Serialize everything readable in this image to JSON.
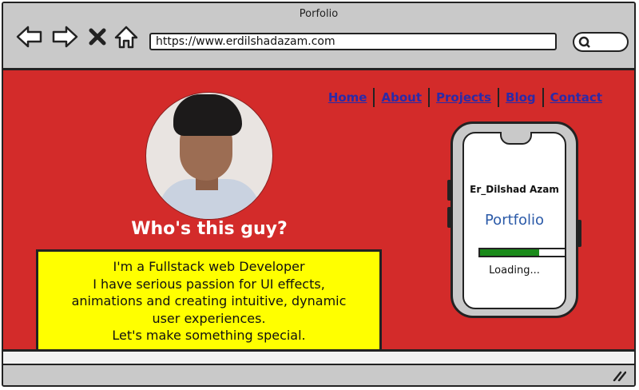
{
  "window": {
    "title": "Porfolio"
  },
  "browser": {
    "url": "https://www.erdilshadazam.com",
    "icons": [
      "back-arrow-icon",
      "forward-arrow-icon",
      "close-icon",
      "home-icon",
      "search-icon"
    ]
  },
  "nav": {
    "home": "Home",
    "about": "About",
    "projects": "Projects",
    "blog": "Blog",
    "contact": "Contact",
    "link_color": "#2b2aa8"
  },
  "hero": {
    "heading": "Who's this guy?",
    "bio_lines": [
      "I'm a Fullstack web Developer",
      "I have serious passion for UI effects,",
      "animations and creating intuitive, dynamic",
      "user experiences.",
      "Let's make something special."
    ]
  },
  "phone": {
    "name": "Er_Dilshad Azam",
    "title": "Portfolio",
    "progress": 0.7,
    "loading": "Loading..."
  },
  "colors": {
    "background": "#d32b2a",
    "bio_box": "#ffff00",
    "progress": "#1a8a1a",
    "portfolio_text": "#2b5aa8"
  }
}
